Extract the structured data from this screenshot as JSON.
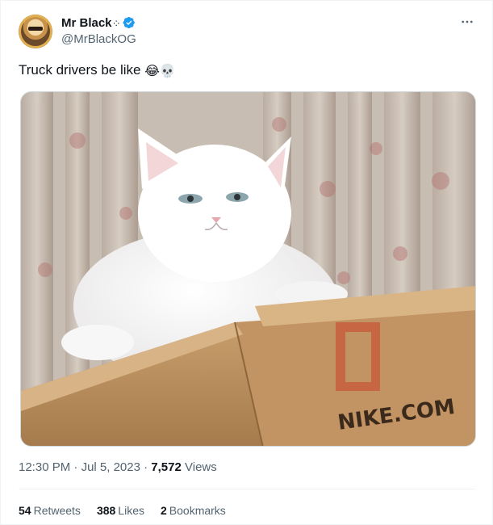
{
  "author": {
    "display_name": "Mr Black",
    "name_decoration": "·:·",
    "handle": "@MrBlackOG",
    "verified": true
  },
  "tweet": {
    "text": "Truck drivers be like ",
    "emojis": [
      "😂",
      "💀"
    ],
    "media_text": "NIKE.COM"
  },
  "meta": {
    "time": "12:30 PM",
    "sep1": " · ",
    "date": "Jul 5, 2023",
    "sep2": " · ",
    "views_count": "7,572",
    "views_label": "Views"
  },
  "stats": [
    {
      "count": "54",
      "label": "Retweets"
    },
    {
      "count": "388",
      "label": "Likes"
    },
    {
      "count": "2",
      "label": "Bookmarks"
    }
  ],
  "colors": {
    "text_primary": "#0f1419",
    "text_secondary": "#536471",
    "verified_blue": "#1d9bf0",
    "border": "#eff3f4"
  },
  "icons": {
    "verified": "verified-badge-icon",
    "more": "more-horizontal-icon"
  }
}
